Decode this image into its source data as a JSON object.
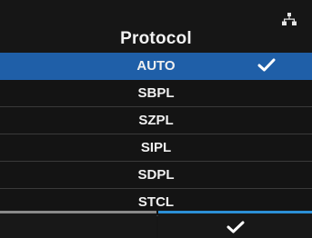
{
  "screen": {
    "title": "Protocol",
    "icons": {
      "status": "network-icon",
      "selected_marker": "checkmark-icon",
      "confirm": "checkmark-icon"
    }
  },
  "protocols": {
    "items": [
      {
        "label": "AUTO",
        "selected": true
      },
      {
        "label": "SBPL",
        "selected": false
      },
      {
        "label": "SZPL",
        "selected": false
      },
      {
        "label": "SIPL",
        "selected": false
      },
      {
        "label": "SDPL",
        "selected": false
      },
      {
        "label": "STCL",
        "selected": false
      }
    ]
  },
  "softkeys": {
    "left_label": "",
    "right_icon": "checkmark-icon"
  },
  "colors": {
    "background": "#161616",
    "selection": "#1f5fa8",
    "confirm_accent": "#2c8fd6",
    "neutral_accent": "#8a8a8a",
    "text": "#f0f0f0"
  }
}
